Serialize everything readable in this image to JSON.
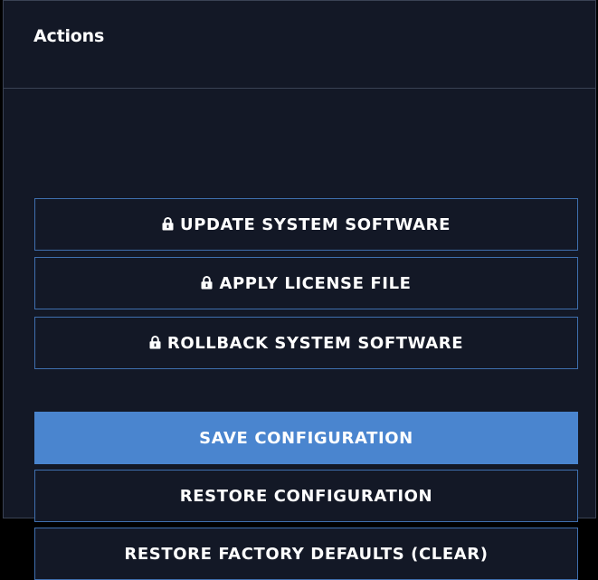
{
  "panel": {
    "title": "Actions"
  },
  "buttons": {
    "update_software": {
      "label": "UPDATE SYSTEM SOFTWARE",
      "locked": true
    },
    "apply_license": {
      "label": "APPLY LICENSE FILE",
      "locked": true
    },
    "rollback_software": {
      "label": "ROLLBACK SYSTEM SOFTWARE",
      "locked": true
    },
    "save_config": {
      "label": "SAVE CONFIGURATION",
      "primary": true
    },
    "restore_config": {
      "label": "RESTORE CONFIGURATION"
    },
    "factory_defaults": {
      "label": "RESTORE FACTORY DEFAULTS (CLEAR)"
    }
  },
  "icons": {
    "lock": "lock-icon"
  },
  "colors": {
    "background": "#131826",
    "border": "#3f6fae",
    "primary": "#4a85cf",
    "text": "#ffffff"
  }
}
